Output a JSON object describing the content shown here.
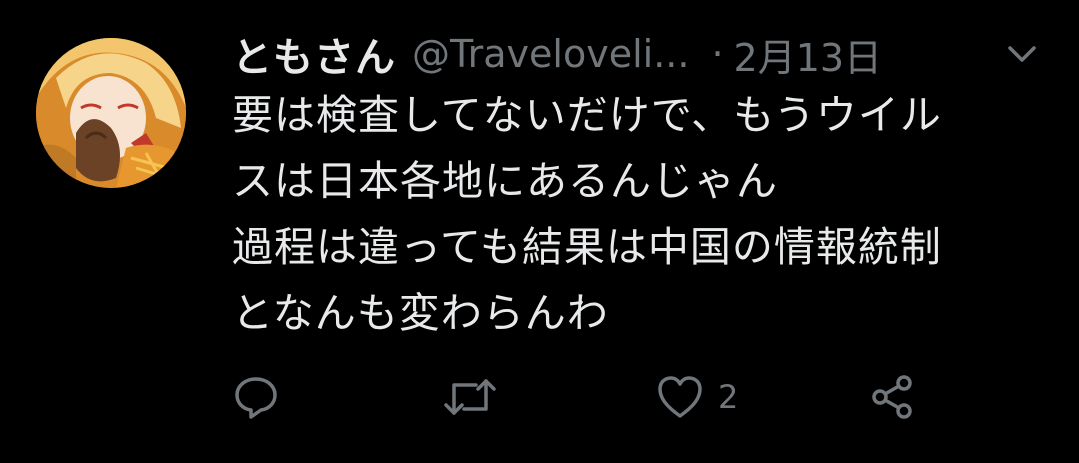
{
  "tweet": {
    "display_name": "ともさん",
    "handle": "@Traveloveli...",
    "separator": "·",
    "date": "2月13日",
    "text_lines": [
      "要は検査してないだけで、もうウイル",
      "スは日本各地にあるんじゃん",
      "過程は違っても結果は中国の情報統制",
      "となんも変わらんわ"
    ]
  },
  "actions": {
    "reply": {
      "icon": "reply-icon"
    },
    "retweet": {
      "icon": "retweet-icon"
    },
    "like": {
      "icon": "heart-icon",
      "count": "2"
    },
    "share": {
      "icon": "share-icon"
    }
  },
  "colors": {
    "background": "#000000",
    "text_primary": "#e7e9ea",
    "text_secondary": "#71767b"
  }
}
